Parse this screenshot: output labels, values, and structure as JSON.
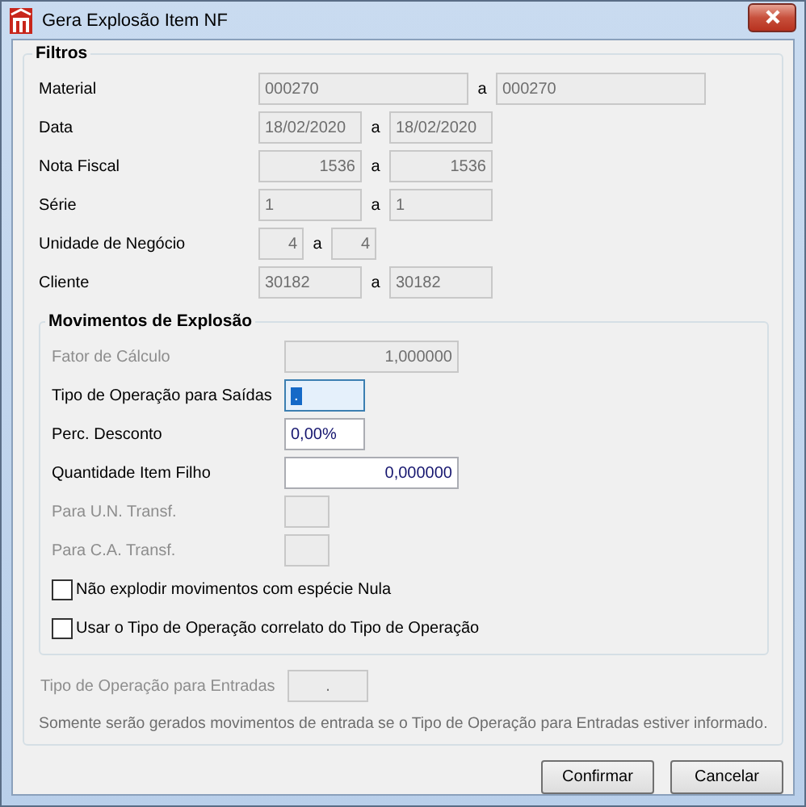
{
  "window": {
    "title": "Gera Explosão Item NF"
  },
  "filtros": {
    "title": "Filtros",
    "rows": [
      {
        "label": "Material",
        "from": {
          "value": "000270",
          "disabled": true
        },
        "separator": "a",
        "to": {
          "value": "000270",
          "disabled": true
        }
      },
      {
        "label": "Data",
        "from": {
          "value": "18/02/2020",
          "disabled": true
        },
        "separator": "a",
        "to": {
          "value": "18/02/2020",
          "disabled": true
        }
      },
      {
        "label": "Nota Fiscal",
        "from": {
          "value": "1536",
          "disabled": true
        },
        "separator": "a",
        "to": {
          "value": "1536",
          "disabled": true
        }
      },
      {
        "label": "Série",
        "from": {
          "value": "1",
          "disabled": true
        },
        "separator": "a",
        "to": {
          "value": "1",
          "disabled": true
        }
      },
      {
        "label": "Unidade de Negócio",
        "from": {
          "value": "4",
          "disabled": true
        },
        "separator": "a",
        "to": {
          "value": "4",
          "disabled": true
        }
      },
      {
        "label": "Cliente",
        "from": {
          "value": "30182",
          "disabled": true
        },
        "separator": "a",
        "to": {
          "value": "30182",
          "disabled": true
        }
      }
    ]
  },
  "movimentos": {
    "title": "Movimentos de Explosão",
    "fields": [
      {
        "label": "Fator de Cálculo",
        "value": "1,000000",
        "disabled": true,
        "focused": false
      },
      {
        "label": "Tipo de Operação para Saídas",
        "value": ".",
        "disabled": false,
        "focused": true
      },
      {
        "label": "Perc. Desconto",
        "value": "0,00%",
        "disabled": false,
        "focused": false
      },
      {
        "label": "Quantidade Item Filho",
        "value": "0,000000",
        "disabled": false,
        "focused": false
      },
      {
        "label": "Para U.N. Transf.",
        "disabled": true,
        "focused": false
      },
      {
        "label": "Para C.A. Transf.",
        "disabled": true,
        "focused": false
      }
    ],
    "checkboxes": [
      {
        "label": "Não explodir movimentos com espécie Nula",
        "checked": false
      },
      {
        "label": "Usar o Tipo de Operação correlato do Tipo de Operação",
        "checked": false
      }
    ]
  },
  "entradas": {
    "label": "Tipo de Operação para Entradas",
    "value": ".",
    "disabled": true
  },
  "note": "Somente serão gerados movimentos de entrada se o Tipo de Operação para Entradas estiver informado.",
  "buttons": [
    {
      "label": "Confirmar"
    },
    {
      "label": "Cancelar"
    }
  ]
}
